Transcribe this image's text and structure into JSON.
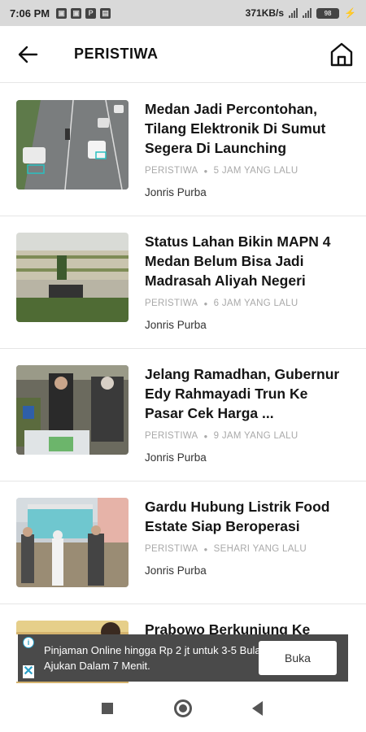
{
  "status_bar": {
    "time": "7:06 PM",
    "left_icons": [
      "notification-icon",
      "notification-icon",
      "p-icon",
      "trash-icon"
    ],
    "network_speed": "371KB/s",
    "battery": "98"
  },
  "header": {
    "title": "PERISTIWA",
    "back_icon": "arrow-left-icon",
    "home_icon": "home-icon"
  },
  "articles": [
    {
      "headline": "Medan Jadi Percontohan, Tilang Elektronik Di Sumut Segera Di Launching",
      "category": "PERISTIWA",
      "time": "5 JAM YANG LALU",
      "author": "Jonris Purba"
    },
    {
      "headline": "Status Lahan Bikin MAPN 4 Medan Belum Bisa Jadi Madrasah Aliyah Negeri",
      "category": "PERISTIWA",
      "time": "6 JAM YANG LALU",
      "author": "Jonris Purba"
    },
    {
      "headline": "Jelang Ramadhan, Gubernur Edy Rahmayadi Trun Ke Pasar Cek Harga ...",
      "category": "PERISTIWA",
      "time": "9 JAM YANG LALU",
      "author": "Jonris Purba"
    },
    {
      "headline": "Gardu Hubung Listrik Food Estate Siap Beroperasi",
      "category": "PERISTIWA",
      "time": "SEHARI YANG LALU",
      "author": "Jonris Purba"
    },
    {
      "headline": "Prabowo Berkunjung Ke"
    }
  ],
  "ad": {
    "text": "Pinjaman Online hingga Rp 2 jt untuk 3-5 Bulan. Ajukan Dalam 7 Menit.",
    "cta": "Buka"
  }
}
